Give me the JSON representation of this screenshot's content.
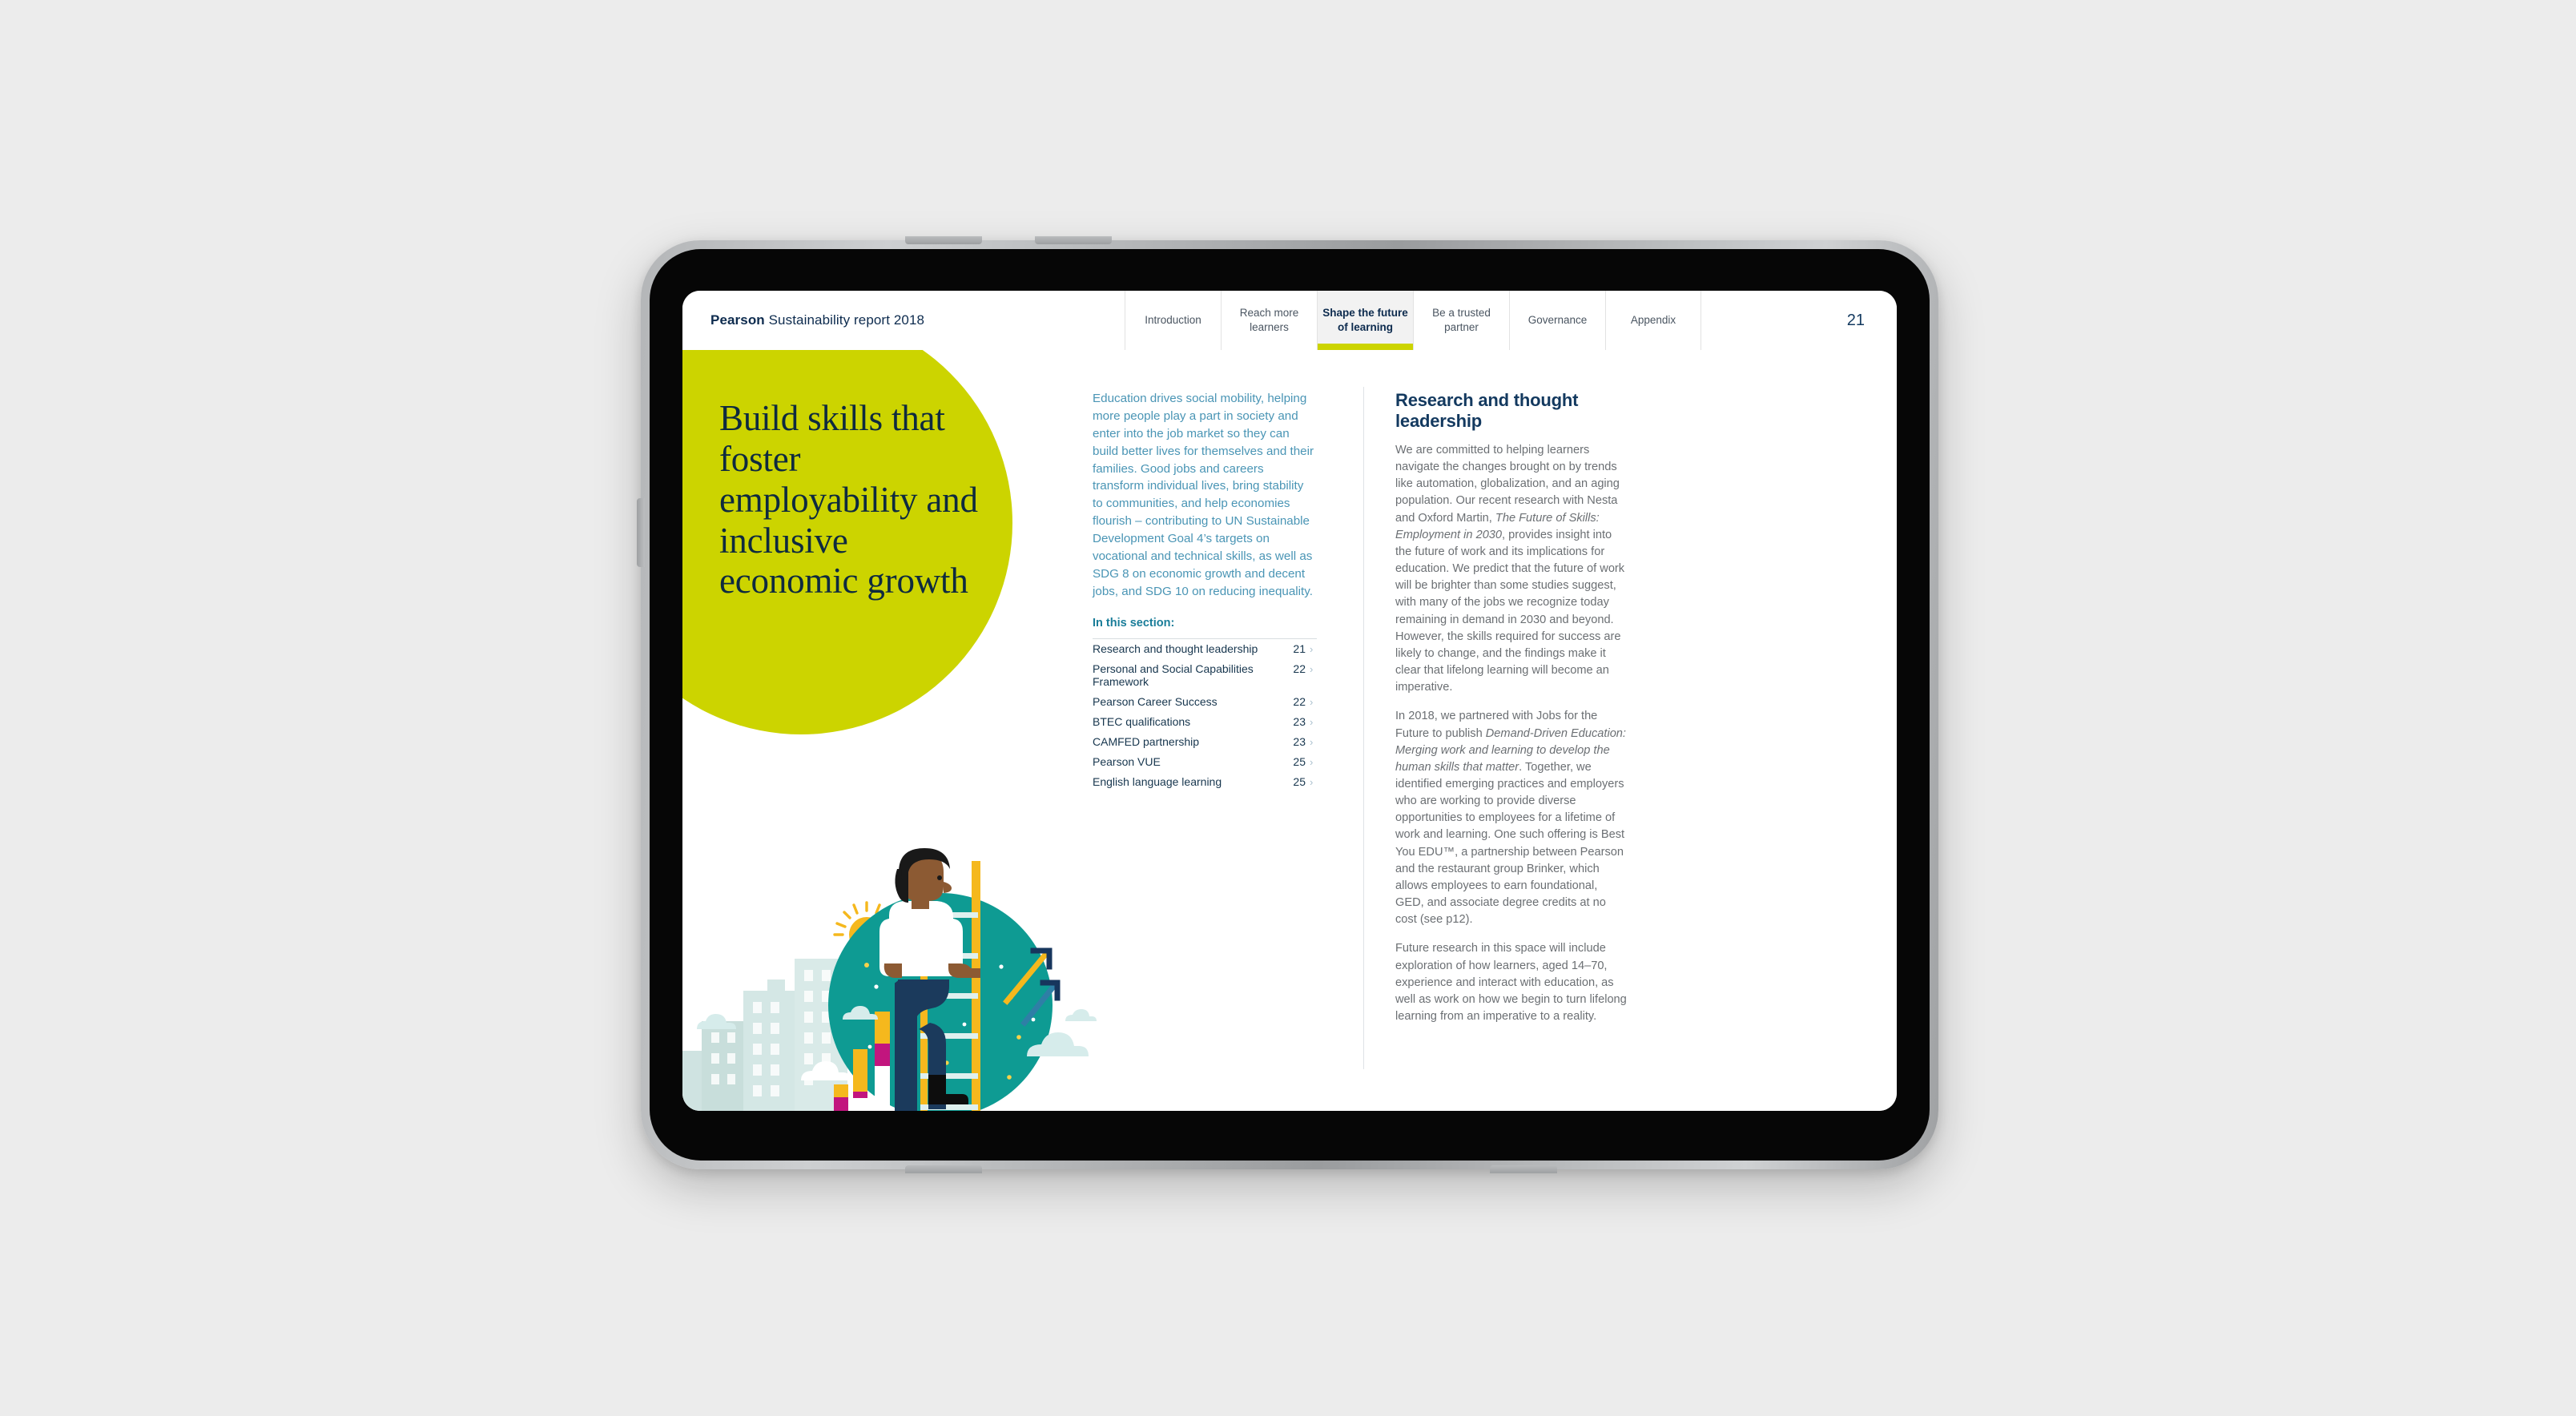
{
  "header": {
    "brand_bold": "Pearson",
    "brand_rest": " Sustainability report 2018",
    "page_number": "21",
    "tabs": [
      {
        "label": "Introduction",
        "active": false
      },
      {
        "label": "Reach more learners",
        "active": false
      },
      {
        "label": "Shape the future of learning",
        "active": true
      },
      {
        "label": "Be a trusted partner",
        "active": false
      },
      {
        "label": "Governance",
        "active": false
      },
      {
        "label": "Appendix",
        "active": false
      }
    ]
  },
  "hero": {
    "headline": "Build skills that foster employability and inclusive economic growth"
  },
  "center": {
    "intro": "Education drives social mobility, helping more people play a part in society and enter into the job market so they can build better lives for themselves and their families. Good jobs and careers transform individual lives, bring stability to communities, and help economies flourish – contributing to UN Sustainable Development Goal 4’s targets on vocational and technical skills, as well as SDG 8 on economic growth and decent jobs, and SDG 10 on reducing inequality.",
    "toc_heading": "In this section:",
    "toc": [
      {
        "label": "Research and thought leadership",
        "page": "21"
      },
      {
        "label": "Personal and Social Capabilities Framework",
        "page": "22"
      },
      {
        "label": "Pearson Career Success",
        "page": "22"
      },
      {
        "label": "BTEC qualifications",
        "page": "23"
      },
      {
        "label": "CAMFED partnership",
        "page": "23"
      },
      {
        "label": "Pearson VUE",
        "page": "25"
      },
      {
        "label": "English language learning",
        "page": "25"
      }
    ],
    "chevron": "›"
  },
  "right": {
    "heading": "Research and thought leadership",
    "paragraphs": [
      {
        "runs": [
          {
            "text": "We are committed to helping learners navigate the changes brought on by trends like automation, globalization, and an aging population. Our recent research with Nesta and Oxford Martin, ",
            "italic": false
          },
          {
            "text": "The Future of Skills: Employment in 2030",
            "italic": true
          },
          {
            "text": ", provides insight into the future of work and its implications for education. We predict that the future of work will be brighter than some studies suggest, with many of the jobs we recognize today remaining in demand in 2030 and beyond. However, the skills required for success are likely to change, and the findings make it clear that lifelong learning will become an imperative.",
            "italic": false
          }
        ]
      },
      {
        "runs": [
          {
            "text": "In 2018, we partnered with Jobs for the Future to publish ",
            "italic": false
          },
          {
            "text": "Demand-Driven Education: Merging work and learning to develop the human skills that matter",
            "italic": true
          },
          {
            "text": ". Together, we identified emerging practices and employers who are working to provide diverse opportunities to employees for a lifetime of work and learning. One such offering is Best You EDU™, a partnership between Pearson and the restaurant group Brinker, which allows employees to earn foundational, GED, and associate degree credits at no cost (see p12).",
            "italic": false
          }
        ]
      },
      {
        "runs": [
          {
            "text": "Future research in this space will include exploration of how learners, aged 14–70, experience and interact with education, as well as work on how we begin to turn lifelong learning from an imperative to a reality.",
            "italic": false
          }
        ]
      }
    ]
  },
  "illustration": {
    "alt": "Person climbing a ladder against a teal circle with city skyline, sun, clouds, bar charts and growth arrows",
    "colors": {
      "teal_circle": "#0e9b93",
      "lime": "#ccd400",
      "yellow": "#f5b81d",
      "navy": "#1b3a5c",
      "magenta": "#c2157e",
      "building_light": "#d6e6e4",
      "building_mid": "#c3dedc",
      "cloud": "#d6eceb",
      "skin": "#8c5a33",
      "shirt": "#ffffff",
      "jeans": "#1b3a5c",
      "shoe": "#0d0d0d"
    }
  },
  "theme": {
    "page_bg": "#ececec",
    "accent_lime": "#ccd400",
    "accent_teal": "#0e9b93",
    "navy": "#13395f",
    "body_gray": "#6b6f73",
    "intro_blue": "#4a95b5"
  }
}
